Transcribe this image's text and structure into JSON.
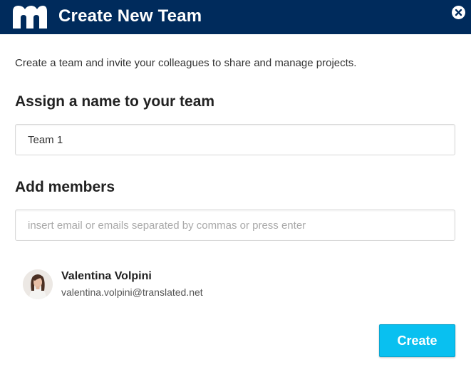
{
  "header": {
    "title": "Create New Team",
    "logo_icon": "matecat-logo-icon",
    "close_icon": "close-icon",
    "background_color": "#002b5c"
  },
  "intro_text": "Create a team and invite your colleagues to share and manage projects.",
  "name_section": {
    "title": "Assign a name to your team",
    "input_value": "Team 1"
  },
  "members_section": {
    "title": "Add members",
    "input_placeholder": "insert email or emails separated by commas or press enter",
    "members": [
      {
        "name": "Valentina Volpini",
        "email": "valentina.volpini@translated.net",
        "avatar_icon": "user-avatar"
      }
    ]
  },
  "actions": {
    "create_label": "Create",
    "create_color": "#09c0f0"
  }
}
